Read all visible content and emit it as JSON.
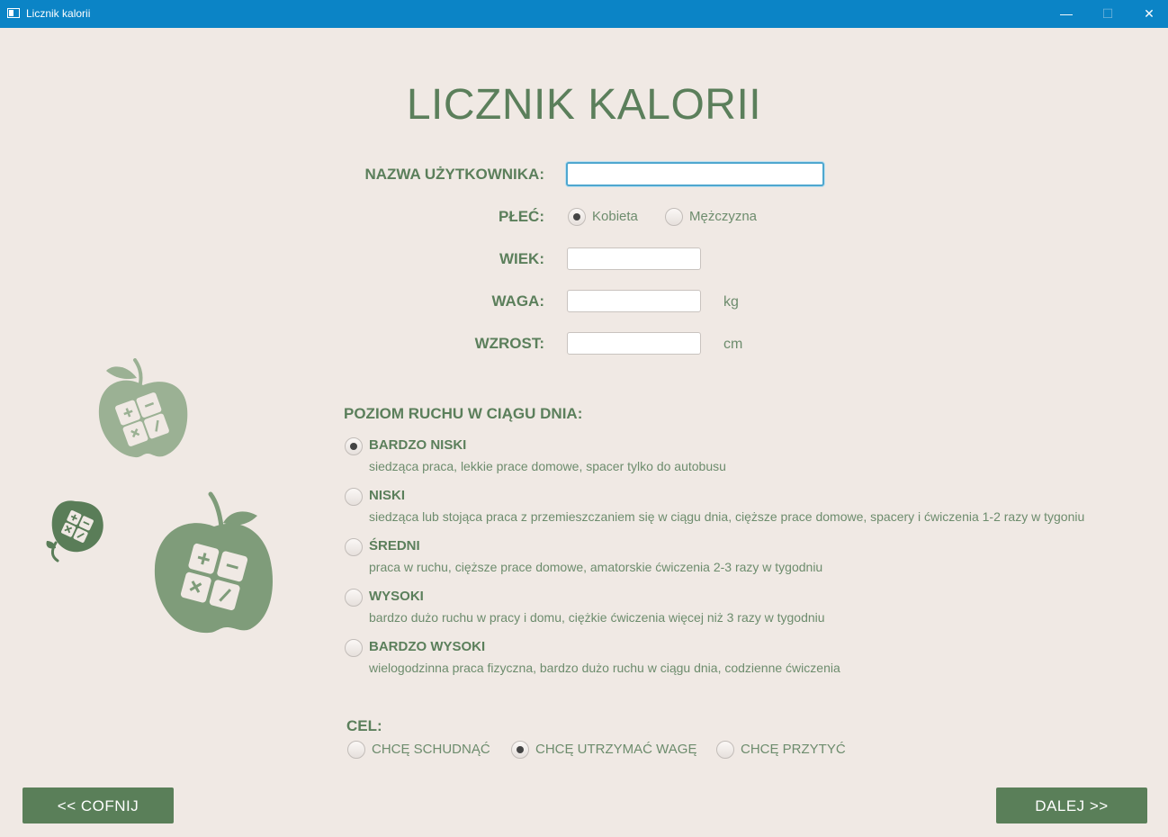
{
  "window": {
    "title": "Licznik kalorii",
    "controls": {
      "minimize": "—",
      "maximize": "☐",
      "close": "✕"
    },
    "icon": "window-app-icon"
  },
  "app_title": "LICZNIK KALORII",
  "form": {
    "username_label": "NAZWA UŻYTKOWNIKA:",
    "username_value": "",
    "gender_label": "PŁEĆ:",
    "gender_options": [
      "Kobieta",
      "Mężczyzna"
    ],
    "gender_selected": "Kobieta",
    "age_label": "WIEK:",
    "age_value": "",
    "weight_label": "WAGA:",
    "weight_value": "",
    "weight_unit": "kg",
    "height_label": "WZROST:",
    "height_value": "",
    "height_unit": "cm"
  },
  "activity": {
    "title": "POZIOM RUCHU W CIĄGU DNIA:",
    "selected": "BARDZO NISKI",
    "levels": [
      {
        "label": "BARDZO NISKI",
        "desc": "siedząca praca, lekkie prace domowe, spacer tylko do autobusu"
      },
      {
        "label": "NISKI",
        "desc": "siedząca lub stojąca praca z przemieszczaniem się w ciągu dnia, cięższe prace domowe, spacery i ćwiczenia 1-2 razy w tygoniu"
      },
      {
        "label": "ŚREDNI",
        "desc": "praca w ruchu, cięższe prace domowe, amatorskie ćwiczenia 2-3 razy w tygodniu"
      },
      {
        "label": "WYSOKI",
        "desc": "bardzo dużo ruchu w pracy i domu, ciężkie ćwiczenia więcej niż 3 razy w tygodniu"
      },
      {
        "label": "BARDZO WYSOKI",
        "desc": "wielogodzinna praca fizyczna, bardzo dużo ruchu w ciągu dnia, codzienne ćwiczenia"
      }
    ]
  },
  "goal": {
    "title": "CEL:",
    "options": [
      "CHCĘ SCHUDNĄĆ",
      "CHCĘ UTRZYMAĆ WAGĘ",
      "CHCĘ PRZYTYĆ"
    ],
    "selected": "CHCĘ UTRZYMAĆ WAGĘ"
  },
  "buttons": {
    "back": "<<  COFNIJ",
    "next": "DALEJ >>"
  },
  "colors": {
    "titlebar": "#0b84c6",
    "background": "#f0e9e4",
    "accent": "#5b7f5b",
    "button": "#5a7f59",
    "apple_light": "#9bb194",
    "apple_mid": "#7f9c7a",
    "apple_dark": "#5a7d58"
  },
  "decorations": [
    "apple-calculator-icon",
    "apple-calculator-icon",
    "apple-calculator-icon"
  ]
}
